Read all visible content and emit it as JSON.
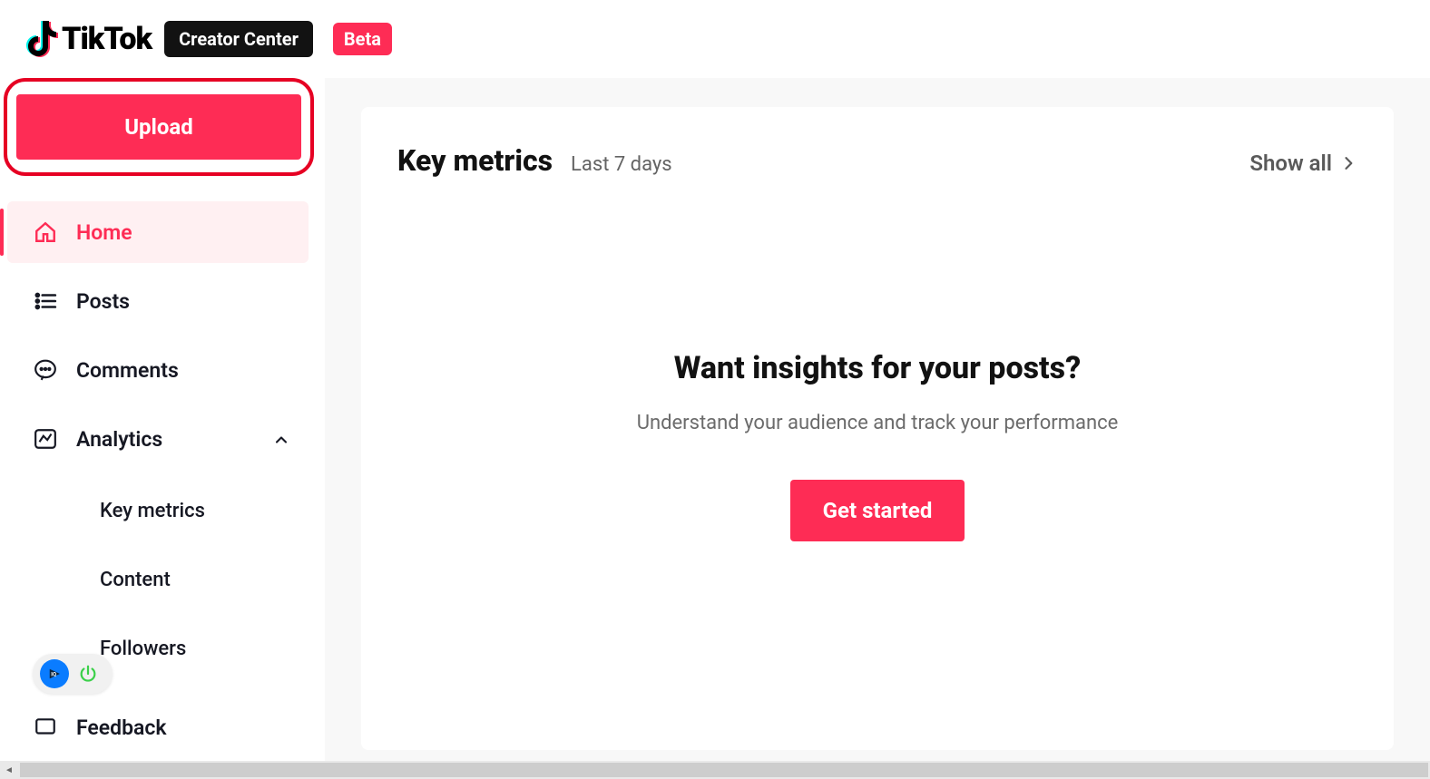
{
  "header": {
    "brand": "TikTok",
    "creator_center": "Creator Center",
    "beta": "Beta"
  },
  "sidebar": {
    "upload_label": "Upload",
    "items": [
      {
        "id": "home",
        "label": "Home",
        "active": true
      },
      {
        "id": "posts",
        "label": "Posts"
      },
      {
        "id": "comments",
        "label": "Comments"
      },
      {
        "id": "analytics",
        "label": "Analytics",
        "expanded": true
      },
      {
        "id": "feedback",
        "label": "Feedback"
      }
    ],
    "analytics_sub": [
      {
        "id": "key-metrics",
        "label": "Key metrics"
      },
      {
        "id": "content",
        "label": "Content"
      },
      {
        "id": "followers",
        "label": "Followers"
      }
    ]
  },
  "main": {
    "card_title": "Key metrics",
    "card_subtitle": "Last 7 days",
    "show_all": "Show all",
    "empty_title": "Want insights for your posts?",
    "empty_subtitle": "Understand your audience and track your performance",
    "get_started": "Get started"
  }
}
